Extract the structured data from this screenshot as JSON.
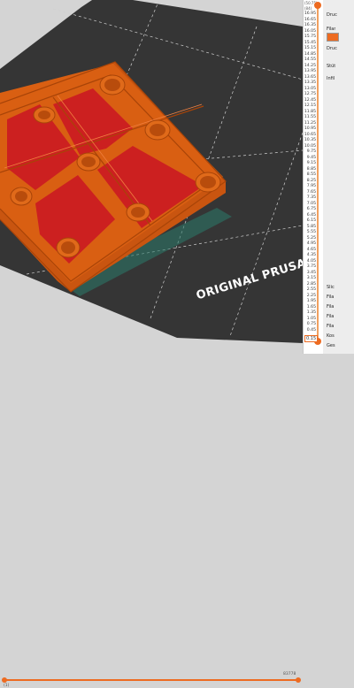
{
  "colors": {
    "accent": "#ed6b21",
    "bed": "#353535",
    "model": "#d95f12",
    "infill": "#cc2020",
    "background": "#d4d4d4"
  },
  "viewport": {
    "bed_logo": "ORIGINAL PRUSA"
  },
  "layer_slider": {
    "top_readout_left": "(50.75)",
    "top_readout_right": "(84)",
    "ticks": [
      "16.95",
      "16.65",
      "16.35",
      "16.05",
      "15.75",
      "15.45",
      "15.15",
      "14.85",
      "14.55",
      "14.25",
      "13.95",
      "13.65",
      "13.35",
      "13.05",
      "12.75",
      "12.45",
      "12.15",
      "11.85",
      "11.55",
      "11.25",
      "10.95",
      "10.65",
      "10.35",
      "10.05",
      "9.75",
      "9.45",
      "9.15",
      "8.85",
      "8.55",
      "8.25",
      "7.95",
      "7.65",
      "7.35",
      "7.05",
      "6.75",
      "6.45",
      "6.15",
      "5.85",
      "5.55",
      "5.25",
      "4.95",
      "4.65",
      "4.35",
      "4.05",
      "3.75",
      "3.45",
      "3.15",
      "2.85",
      "2.55",
      "2.25",
      "1.95",
      "1.65",
      "1.35",
      "1.05",
      "0.75",
      "0.45"
    ],
    "bottom_value": "0.15"
  },
  "horizontal_slider": {
    "right_readout": "83778",
    "left_readout": "(1)"
  },
  "side_panel": {
    "print_label": "Druc",
    "filament_label": "Filar",
    "printer_label": "Druc",
    "support_label": "Stüt",
    "infill_label": "Infil",
    "bottom_labels": [
      "Slic",
      "Fila",
      "Fila",
      "Fila",
      "Fila",
      "Kos",
      "Ges"
    ]
  }
}
